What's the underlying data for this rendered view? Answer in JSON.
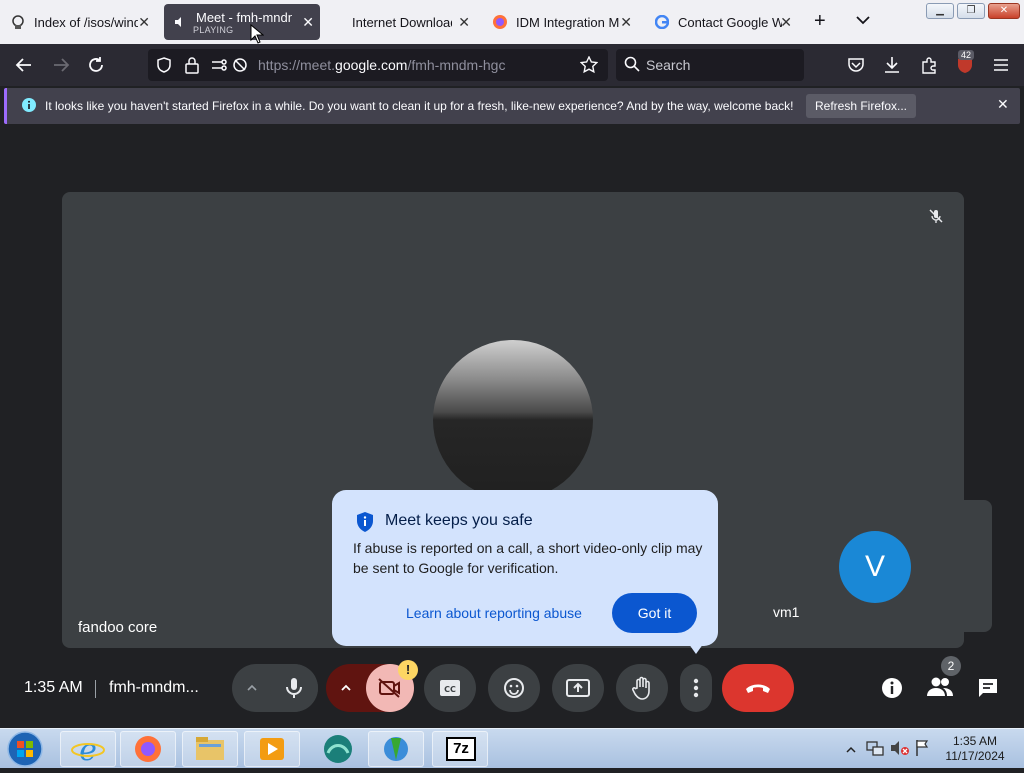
{
  "browser": {
    "tabs": [
      {
        "title": "Index of /isos/wind",
        "icon": "page-icon",
        "active": false
      },
      {
        "title": "Meet - fmh-mndm",
        "subtitle": "PLAYING",
        "icon": "speaker-icon",
        "active": true
      },
      {
        "title": "Internet Download",
        "icon": "none",
        "active": false
      },
      {
        "title": "IDM Integration Mo",
        "icon": "firefox-icon",
        "active": false
      },
      {
        "title": "Contact Google We",
        "icon": "google-icon",
        "active": false
      }
    ],
    "new_tab": "+",
    "url_prefix": "https://meet.",
    "url_domain": "google.com",
    "url_path": "/fmh-mndm-hgc",
    "search_placeholder": "Search",
    "extension_badge": "42"
  },
  "notification": {
    "text": "It looks like you haven't started Firefox in a while. Do you want to clean it up for a fresh, like-new experience? And by the way, welcome back!",
    "button": "Refresh Firefox..."
  },
  "meet": {
    "main_participant": "fandoo core",
    "pip_participant": "vm1",
    "pip_initial": "V",
    "popup": {
      "title": "Meet keeps you safe",
      "body": "If abuse is reported on a call, a short video-only clip may be sent to Google for verification.",
      "learn_link": "Learn about reporting abuse",
      "got_it": "Got it"
    },
    "time": "1:35 AM",
    "meeting_code": "fmh-mndm...",
    "camera_warning": "!",
    "people_count": "2"
  },
  "taskbar": {
    "time": "1:35 AM",
    "date": "11/17/2024",
    "apps": [
      "internet-explorer",
      "firefox",
      "file-explorer",
      "media-player",
      "pinned-app",
      "idm",
      "7zip"
    ],
    "sevenzip_label": "7z"
  },
  "colors": {
    "meet_bg": "#202124",
    "end_call": "#dc362e",
    "popup_bg": "#d3e3fd",
    "primary_blue": "#0b57d0",
    "camera_off": "#f9dedc"
  }
}
